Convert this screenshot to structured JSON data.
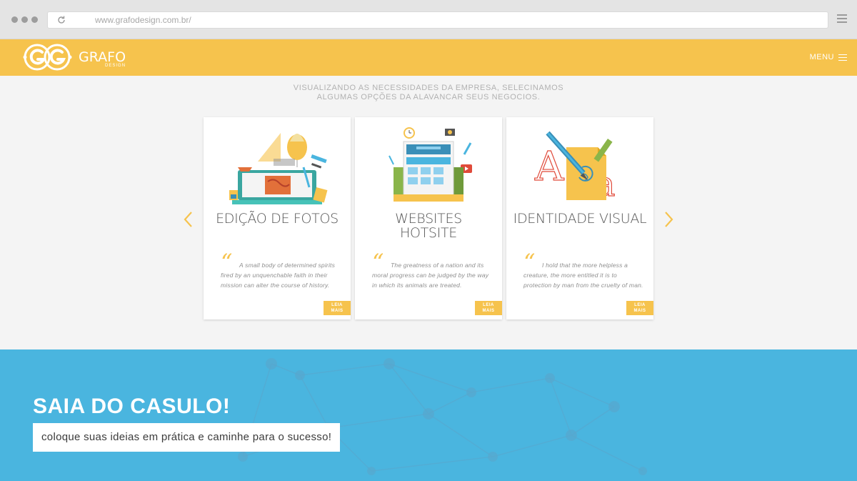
{
  "browser": {
    "url": "www.grafodesign.com.br/"
  },
  "header": {
    "logo_text": "GRAFO",
    "logo_sub": "DESIGN",
    "menu_label": "MENU"
  },
  "services": {
    "intro_line1": "VISUALIZANDO AS NECESSIDADES DA EMPRESA, SELECINAMOS",
    "intro_line2": "ALGUMAS OPÇÕES DA ALAVANCAR SEUS NEGOCIOS.",
    "cards": [
      {
        "title_line1": "EDIÇÃO DE FOTOS",
        "title_line2": "",
        "quote": "A small body of determined spirits fired by an unquenchable faith in their mission can alter the course of history.",
        "button_line1": "LEIA",
        "button_line2": "MAIS"
      },
      {
        "title_line1": "WEBSITES",
        "title_line2": "HOTSITE",
        "quote": "The greatness of a nation and its moral progress can be judged by the way in which its animals are treated.",
        "button_line1": "LEIA",
        "button_line2": "MAIS"
      },
      {
        "title_line1": "IDENTIDADE VISUAL",
        "title_line2": "",
        "quote": "I hold that the more helpless a creature, the more entitled it is to protection by man from the cruelty of man.",
        "button_line1": "LEIA",
        "button_line2": "MAIS"
      }
    ]
  },
  "banner": {
    "title": "SAIA DO CASULO!",
    "subtitle": "coloque suas ideias em prática e caminhe para o sucesso!"
  },
  "colors": {
    "brand_yellow": "#f6c34d",
    "banner_blue": "#4ab5df",
    "background": "#f4f4f4"
  }
}
